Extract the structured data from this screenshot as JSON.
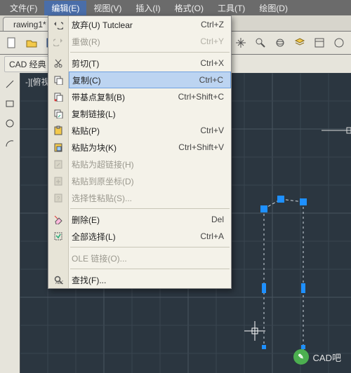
{
  "menubar": {
    "items": [
      {
        "label": "文件(F)"
      },
      {
        "label": "编辑(E)"
      },
      {
        "label": "视图(V)"
      },
      {
        "label": "插入(I)"
      },
      {
        "label": "格式(O)"
      },
      {
        "label": "工具(T)"
      },
      {
        "label": "绘图(D)"
      }
    ],
    "open_index": 1
  },
  "tab": {
    "label": "rawing1*"
  },
  "workspace": {
    "label": "CAD 经典"
  },
  "drawing_caption": "-][俯视][二维",
  "dropdown": {
    "groups": [
      [
        {
          "icon": "undo-icon",
          "label": "放弃(U)  Tutclear",
          "shortcut": "Ctrl+Z",
          "enabled": true
        },
        {
          "icon": "redo-icon",
          "label": "重做(R)",
          "shortcut": "Ctrl+Y",
          "enabled": false
        }
      ],
      [
        {
          "icon": "cut-icon",
          "label": "剪切(T)",
          "shortcut": "Ctrl+X",
          "enabled": true
        },
        {
          "icon": "copy-icon",
          "label": "复制(C)",
          "shortcut": "Ctrl+C",
          "enabled": true,
          "highlight": true
        },
        {
          "icon": "copy-base-icon",
          "label": "带基点复制(B)",
          "shortcut": "Ctrl+Shift+C",
          "enabled": true
        },
        {
          "icon": "copy-link-icon",
          "label": "复制链接(L)",
          "shortcut": "",
          "enabled": true
        },
        {
          "icon": "paste-icon",
          "label": "粘贴(P)",
          "shortcut": "Ctrl+V",
          "enabled": true
        },
        {
          "icon": "paste-block-icon",
          "label": "粘贴为块(K)",
          "shortcut": "Ctrl+Shift+V",
          "enabled": true
        },
        {
          "icon": "paste-link-icon",
          "label": "粘贴为超链接(H)",
          "shortcut": "",
          "enabled": false
        },
        {
          "icon": "paste-orig-icon",
          "label": "粘贴到原坐标(D)",
          "shortcut": "",
          "enabled": false
        },
        {
          "icon": "paste-special-icon",
          "label": "选择性粘贴(S)...",
          "shortcut": "",
          "enabled": false
        }
      ],
      [
        {
          "icon": "erase-icon",
          "label": "删除(E)",
          "shortcut": "Del",
          "enabled": true
        },
        {
          "icon": "select-all-icon",
          "label": "全部选择(L)",
          "shortcut": "Ctrl+A",
          "enabled": true
        }
      ],
      [
        {
          "icon": "",
          "label": "OLE 链接(O)...",
          "shortcut": "",
          "enabled": false
        }
      ],
      [
        {
          "icon": "find-icon",
          "label": "查找(F)...",
          "shortcut": "",
          "enabled": true
        }
      ]
    ]
  },
  "toolbar_icons": [
    "new-icon",
    "open-icon",
    "save-icon",
    "print-icon",
    "undo-icon",
    "redo-icon"
  ],
  "right_toolbar_icons": [
    "pan-icon",
    "zoom-icon",
    "orbit-icon",
    "layers-icon",
    "props-icon",
    "help-icon"
  ],
  "left_palette_icons": [
    "line-icon",
    "rect-icon",
    "circle-icon",
    "arc-icon",
    "poly-icon"
  ],
  "watermark": {
    "badge": "CAD",
    "label": "CAD吧"
  }
}
